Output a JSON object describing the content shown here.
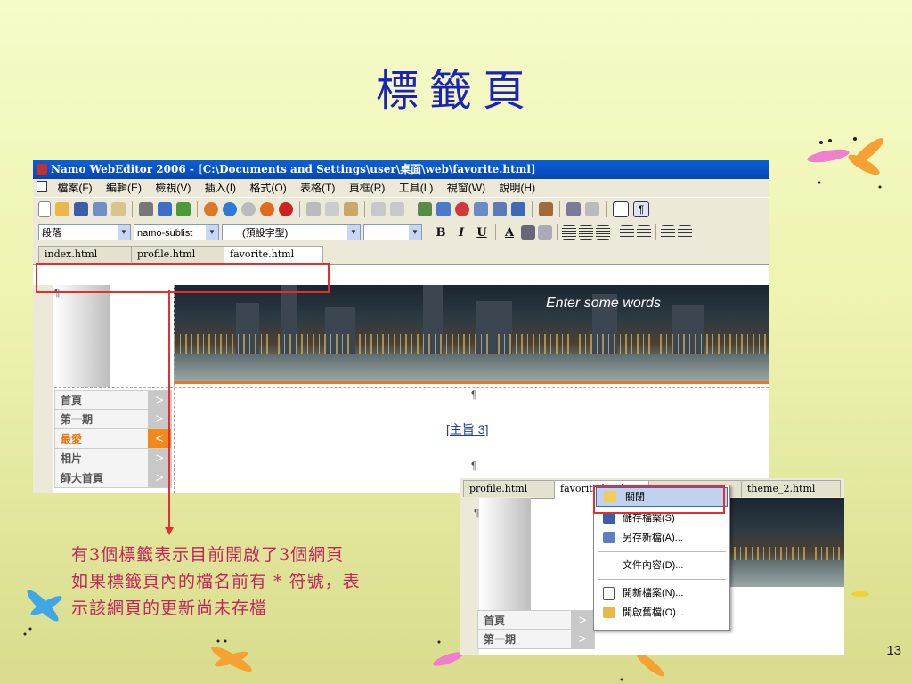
{
  "slide": {
    "title": "標籤頁",
    "page_number": "13",
    "caption_lines": [
      "有3個標籤表示目前開啟了3個網頁",
      "如果標籤頁內的檔名前有 * 符號，表",
      "示該網頁的更新尚未存檔"
    ]
  },
  "app": {
    "title": "Namo WebEditor 2006 - [C:\\Documents and Settings\\user\\桌面\\web\\favorite.html]",
    "menus": [
      "檔案(F)",
      "編輯(E)",
      "檢視(V)",
      "插入(I)",
      "格式(O)",
      "表格(T)",
      "頁框(R)",
      "工具(L)",
      "視窗(W)",
      "說明(H)"
    ],
    "format": {
      "paragraph": "段落",
      "style": "namo-sublist",
      "font": "(預設字型)",
      "size": ""
    },
    "tabs": [
      "index.html",
      "profile.html",
      "favorite.html"
    ],
    "banner_text": "Enter some words",
    "theme_link": "主旨 3",
    "nav_items": [
      {
        "label": "首頁",
        "active": false
      },
      {
        "label": "第一期",
        "active": false
      },
      {
        "label": "最愛",
        "active": true
      },
      {
        "label": "相片",
        "active": false
      },
      {
        "label": "師大首頁",
        "active": false
      }
    ]
  },
  "second_window": {
    "tabs": [
      "profile.html",
      "favorite.html",
      "",
      "theme_2.html"
    ],
    "nav_items": [
      "首頁",
      "第一期"
    ]
  },
  "context_menu": {
    "items": [
      {
        "label": "關閉",
        "icon": "folder-icon",
        "highlighted": true
      },
      {
        "label": "儲存檔案(S)",
        "icon": "save-icon"
      },
      {
        "label": "另存新檔(A)...",
        "icon": "save-as-icon"
      },
      {
        "label": "文件內容(D)...",
        "icon": ""
      },
      {
        "label": "開新檔案(N)...",
        "icon": "new-file-icon"
      },
      {
        "label": "開啟舊檔(O)...",
        "icon": "open-folder-icon"
      }
    ]
  },
  "colors": {
    "title": "#1b23b8",
    "caption": "#c2255a",
    "highlight": "#e23030",
    "accent_orange": "#f08a1e"
  }
}
